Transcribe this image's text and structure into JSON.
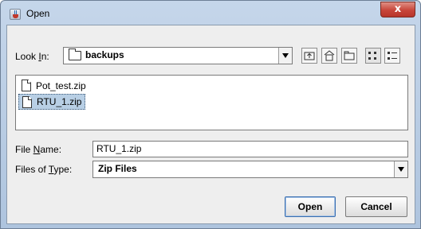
{
  "window": {
    "title": "Open",
    "close_label": "x"
  },
  "look_in": {
    "label_pre": "Look ",
    "label_mnemonic": "I",
    "label_post": "n:",
    "value": "backups"
  },
  "toolbar": [
    "up-folder",
    "home",
    "new-folder",
    "list-view",
    "details-view"
  ],
  "files": [
    {
      "name": "Pot_test.zip",
      "selected": false
    },
    {
      "name": "RTU_1.zip",
      "selected": true
    }
  ],
  "file_name": {
    "label_pre": "File ",
    "label_mnemonic": "N",
    "label_post": "ame:",
    "value": "RTU_1.zip"
  },
  "file_type": {
    "label_pre": "Files of ",
    "label_mnemonic": "T",
    "label_post": "ype:",
    "value": "Zip Files"
  },
  "buttons": {
    "open": "Open",
    "cancel": "Cancel"
  },
  "colors": {
    "selection": "#b8cfe5",
    "close": "#c7453a",
    "frame": "#aec4de"
  }
}
